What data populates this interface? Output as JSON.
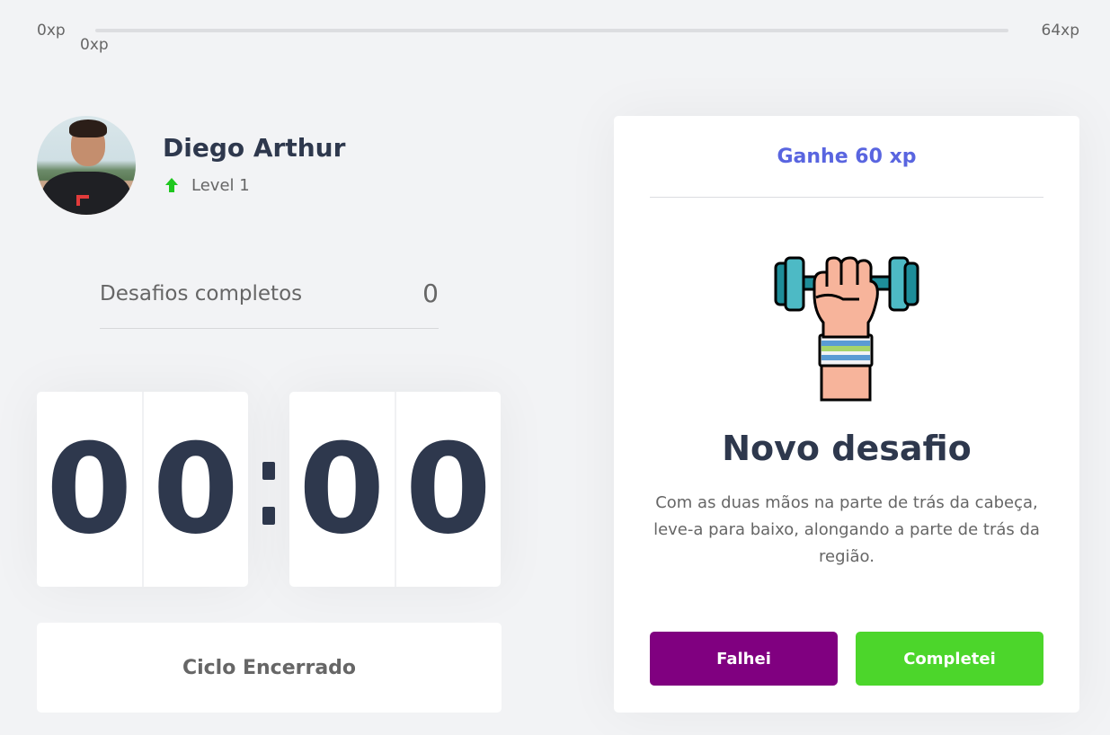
{
  "xp_bar": {
    "min_label": "0xp",
    "current_label": "0xp",
    "max_label": "64xp",
    "progress_fraction": 0
  },
  "profile": {
    "name": "Diego Arthur",
    "level": "Level 1",
    "level_icon": "level-up-arrow-icon"
  },
  "stats": {
    "completed_label": "Desafios completos",
    "completed_value": "0"
  },
  "countdown": {
    "minute_left": "0",
    "minute_right": "0",
    "second_left": "0",
    "second_right": "0"
  },
  "cycle_button": {
    "label": "Ciclo Encerrado"
  },
  "challenge": {
    "header": "Ganhe 60 xp",
    "icon": "dumbbell-fist-icon",
    "title": "Novo desafio",
    "description": "Com as duas mãos na parte de trás da cabeça, leve-a para baixo, alongando a parte de trás da região.",
    "fail_label": "Falhei",
    "success_label": "Completei"
  },
  "colors": {
    "background": "#f2f3f5",
    "title": "#2e384d",
    "text": "#666666",
    "blue": "#5965e0",
    "green": "#4cd62b",
    "purple": "#800080"
  }
}
